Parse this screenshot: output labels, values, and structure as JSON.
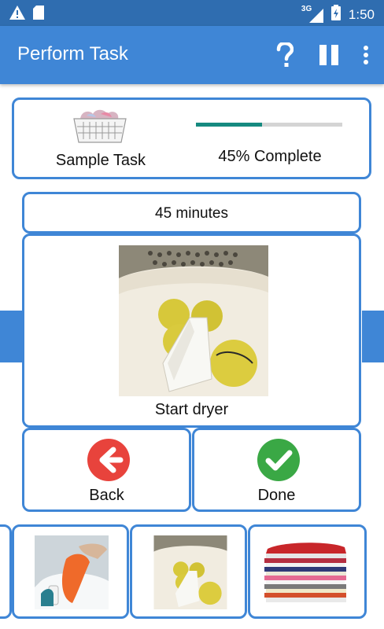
{
  "status_bar": {
    "network_label": "3G",
    "time": "1:50",
    "icons": [
      "warning-icon",
      "sd-card-icon",
      "signal-icon",
      "battery-icon"
    ]
  },
  "app_bar": {
    "title": "Perform Task",
    "actions": [
      "help-icon",
      "pause-icon",
      "overflow-menu-icon"
    ]
  },
  "task": {
    "name": "Sample Task",
    "progress_percent": 45,
    "progress_text": "45% Complete"
  },
  "current_step": {
    "duration": "45 minutes",
    "label": "Start dryer"
  },
  "controls": {
    "back_label": "Back",
    "done_label": "Done"
  },
  "thumbnails": [
    "washing-clothes",
    "dryer-with-tennis-balls",
    "folded-clothes-stack"
  ],
  "colors": {
    "status_bar": "#2f6db0",
    "app_bar": "#3f86d6",
    "card_border": "#3f86d6",
    "progress_fill": "#168a80",
    "progress_track": "#d4d4d4",
    "back_button": "#e8433c",
    "done_button": "#3aa845"
  }
}
